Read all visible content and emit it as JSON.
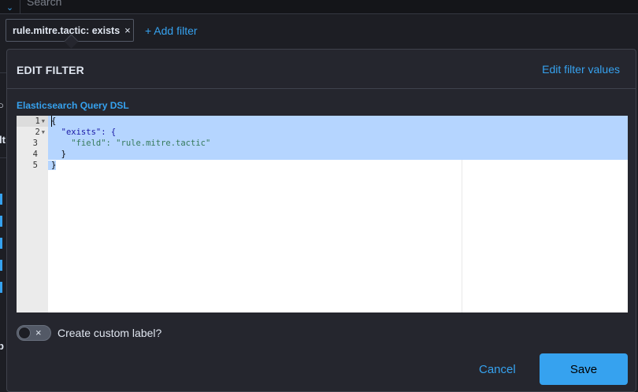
{
  "topbar": {
    "search_text": "Search"
  },
  "filter_pill": {
    "label": "rule.mitre.tactic: exists",
    "close": "×"
  },
  "add_filter": {
    "label": "+ Add filter"
  },
  "background_fragments": {
    "left_text": "lt",
    "left_text_2": "p"
  },
  "popover": {
    "title": "EDIT FILTER",
    "edit_values_link": "Edit filter values",
    "dsl_label": "Elasticsearch Query DSL",
    "editor": {
      "line_numbers": [
        "1",
        "2",
        "3",
        "4",
        "5"
      ],
      "lines": [
        "{",
        "  \"exists\": {",
        "    \"field\": \"rule.mitre.tactic\"",
        "  }",
        "}"
      ]
    },
    "custom_label": {
      "label": "Create custom label?",
      "enabled": false,
      "off_glyph": "×"
    },
    "buttons": {
      "cancel": "Cancel",
      "save": "Save"
    }
  },
  "colors": {
    "accent": "#36a2ef",
    "background": "#1d1e24",
    "panel": "#25262e",
    "selection": "#b5d5ff"
  }
}
